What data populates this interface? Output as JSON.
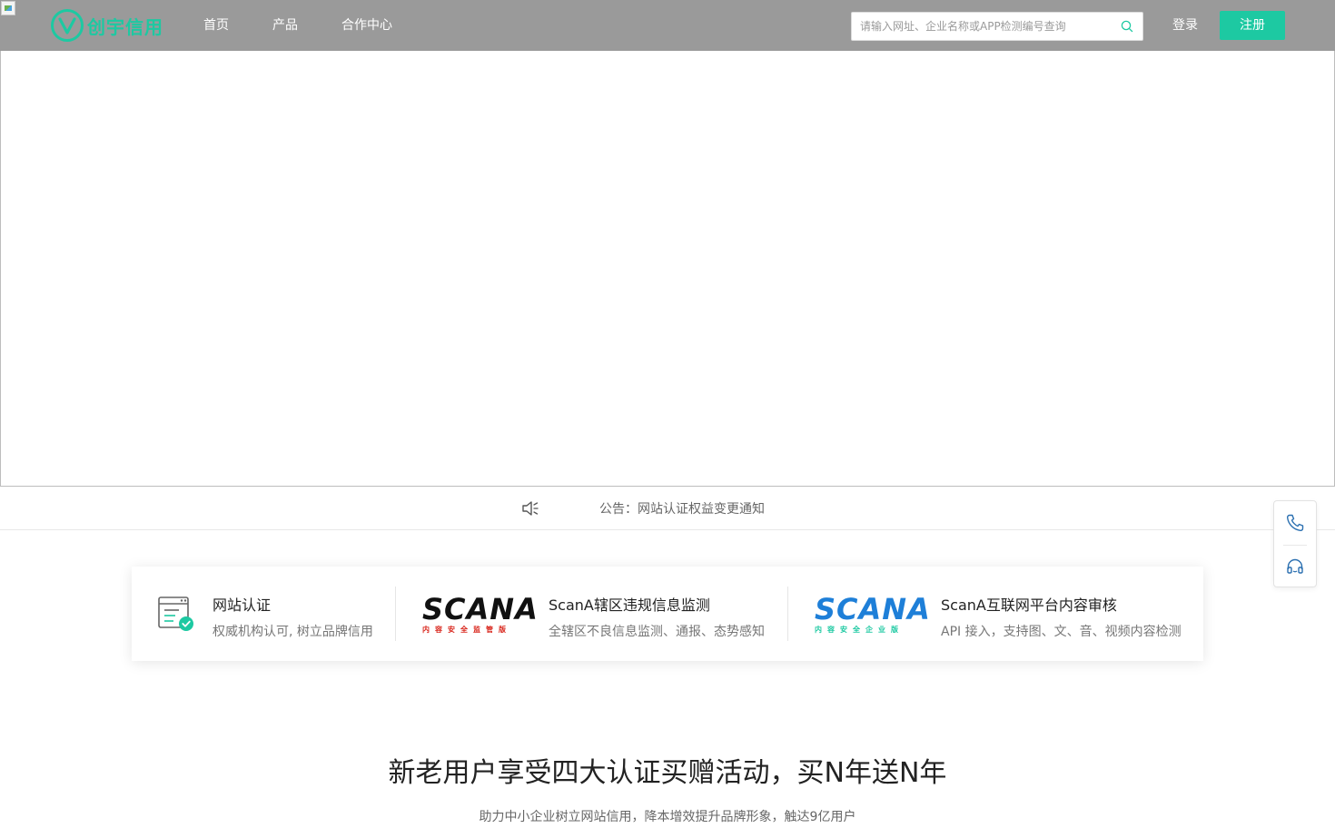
{
  "header": {
    "brand": "创宇信用",
    "nav": [
      {
        "label": "首页"
      },
      {
        "label": "产品"
      },
      {
        "label": "合作中心"
      }
    ],
    "search": {
      "placeholder": "请输入网址、企业名称或APP检测编号查询"
    },
    "login_label": "登录",
    "register_label": "注册"
  },
  "notice": {
    "text": "公告：网站认证权益变更通知"
  },
  "products": [
    {
      "title": "网站认证",
      "desc": "权威机构认可, 树立品牌信用"
    },
    {
      "title": "ScanA辖区违规信息监测",
      "desc": "全辖区不良信息监测、通报、态势感知",
      "logo_word": "SCANA",
      "logo_sub": "内容安全监管版"
    },
    {
      "title": "ScanA互联网平台内容审核",
      "desc": "API 接入，支持图、文、音、视频内容检测",
      "logo_word": "SCANA",
      "logo_sub": "内容安全企业版"
    }
  ],
  "promo": {
    "title": "新老用户享受四大认证买赠活动，买N年送N年",
    "subtitle": "助力中小企业树立网站信用，降本增效提升品牌形象，触达9亿用户"
  },
  "colors": {
    "brand": "#1dc9a2",
    "header_bg": "#9a9a9a",
    "scana_regulator_red": "#d9261c",
    "scana_enterprise_blue": "#1e7fd8"
  },
  "icons": {
    "search": "search-icon",
    "speaker": "speaker-icon",
    "phone": "phone-icon",
    "headset": "headset-icon",
    "certificate": "certificate-icon"
  }
}
